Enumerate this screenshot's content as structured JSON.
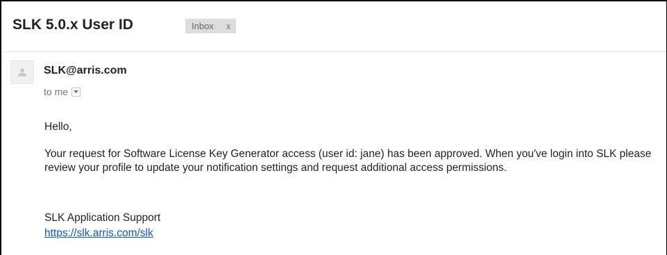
{
  "email": {
    "subject": "SLK 5.0.x User ID",
    "label": "Inbox",
    "label_close": "x",
    "sender": "SLK@arris.com",
    "recipient": "to me",
    "greeting": "Hello,",
    "paragraph": "Your request for Software License Key Generator access (user id: jane) has been approved. When you've login into SLK please review your profile to update your notification settings and request additional access permissions.",
    "signature": "SLK Application Support",
    "link_text": "https://slk.arris.com/slk"
  },
  "icons": {
    "avatar": "person-silhouette-icon",
    "details_toggle": "chevron-down-icon"
  },
  "colors": {
    "link": "#1155cc",
    "label_background": "#dddddd",
    "muted_text": "#777777"
  }
}
